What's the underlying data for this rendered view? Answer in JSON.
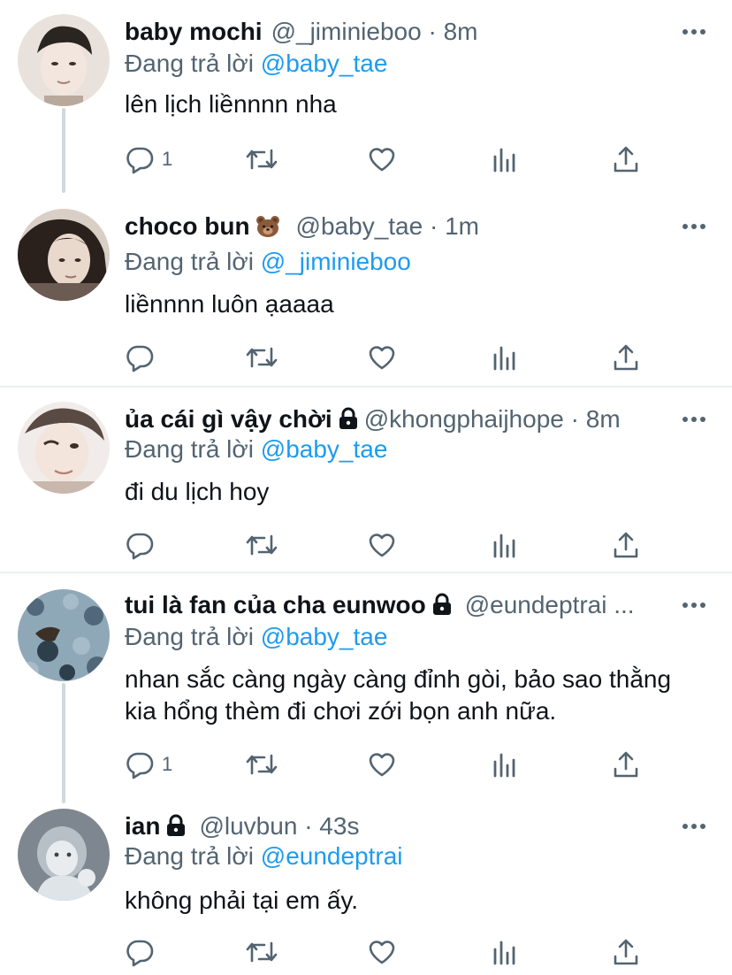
{
  "tweets": [
    {
      "name": "baby mochi",
      "handle": "@_jiminieboo",
      "sep": "·",
      "time": "8m",
      "reply_prefix": "Đang trả lời",
      "reply_to": "@baby_tae",
      "text": "lên lịch liềnnnn nha",
      "reply_count": "1",
      "avatar_colors": [
        "#e9e2dc",
        "#b9a89c",
        "#2b2522"
      ]
    },
    {
      "name": "choco bun",
      "emoji_icon": "bear-face-icon",
      "handle": "@baby_tae",
      "sep": "·",
      "time": "1m",
      "reply_prefix": "Đang trả lời",
      "reply_to": "@_jiminieboo",
      "text": "liềnnnn luôn ạaaaa",
      "reply_count": "",
      "avatar_colors": [
        "#d9cfc7",
        "#6b5b52",
        "#2a211c"
      ]
    },
    {
      "name": "ủa cái gì vậy chời",
      "lock_icon": "lock-icon",
      "handle": "@khongphaijhope",
      "sep": "·",
      "time": "8m",
      "reply_prefix": "Đang trả lời",
      "reply_to": "@baby_tae",
      "text": "đi du lịch hoy",
      "reply_count": "",
      "avatar_colors": [
        "#f1ece9",
        "#c9b7ae",
        "#5a4a44"
      ]
    },
    {
      "name": "tui là fan của cha eunwoo",
      "lock_icon": "lock-icon",
      "handle": "@eundeptrai ...",
      "sep": "",
      "time": "",
      "reply_prefix": "Đang trả lời",
      "reply_to": "@baby_tae",
      "text": "nhan sắc càng ngày càng đỉnh gòi, bảo sao thằng kia hổng thèm đi chơi zới bọn anh nữa.",
      "reply_count": "1",
      "avatar_colors": [
        "#8fa8b8",
        "#51687a",
        "#2e3f4c"
      ]
    },
    {
      "name": "ian",
      "lock_icon": "lock-icon",
      "handle": "@luvbun",
      "sep": "·",
      "time": "43s",
      "reply_prefix": "Đang trả lời",
      "reply_to": "@eundeptrai",
      "text": "không phải tại em ấy.",
      "reply_count": "",
      "avatar_colors": [
        "#b7bfc7",
        "#7e8790",
        "#e8ecef"
      ]
    }
  ],
  "colors": {
    "text_primary": "#0f1419",
    "text_secondary": "#536471",
    "link": "#1d9bf0",
    "divider": "#eceff1",
    "thread_line": "#cfd9de"
  },
  "icons": {
    "reply": "reply-bubble-icon",
    "retweet": "retweet-icon",
    "like": "heart-icon",
    "stats": "bar-chart-icon",
    "share": "share-upload-icon",
    "more": "more-dots-icon"
  }
}
